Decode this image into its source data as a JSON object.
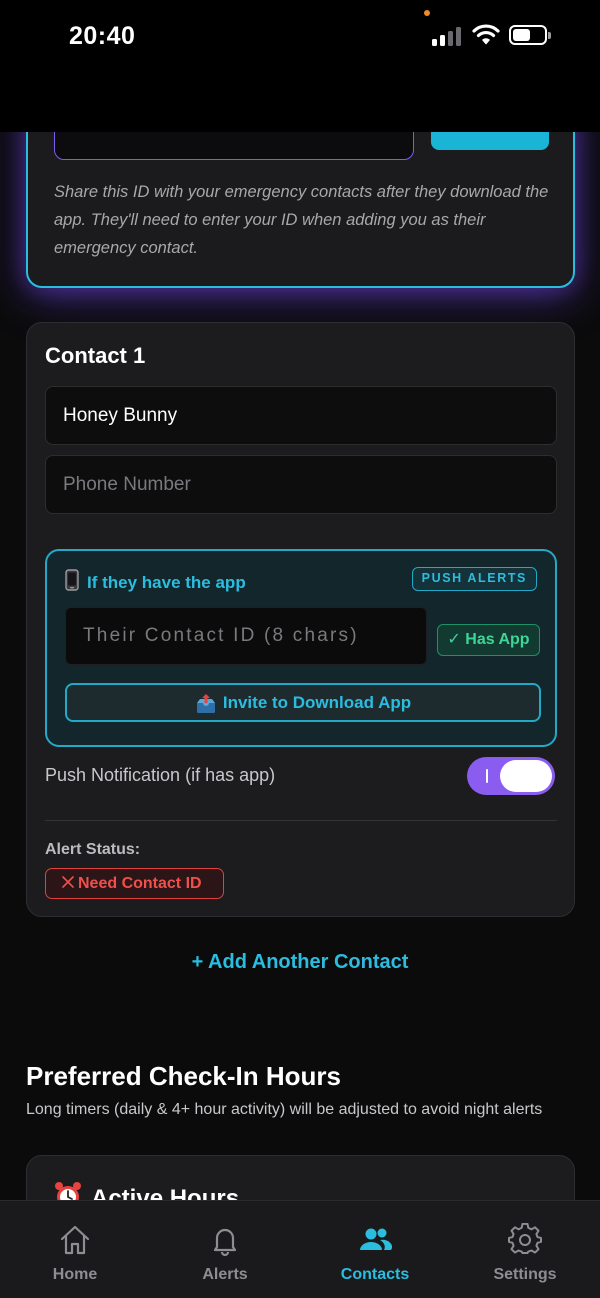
{
  "status_bar": {
    "time": "20:40"
  },
  "id_card": {
    "help_text": "Share this ID with your emergency contacts after they download the app. They'll need to enter your ID when adding you as their emergency contact."
  },
  "contact": {
    "title": "Contact 1",
    "name_value": "Honey Bunny",
    "phone_placeholder": "Phone Number",
    "app_section": {
      "icon": "mobile-phone-icon",
      "heading": "If they have the app",
      "badge": "PUSH ALERTS",
      "contact_id_placeholder": "Their Contact ID (8 chars)",
      "has_app_label": "✓ Has App",
      "invite_label": "Invite to Download App",
      "invite_icon": "outbox-tray-icon"
    },
    "push_label": "Push Notification (if has app)",
    "push_enabled": true,
    "alert_status_label": "Alert Status:",
    "alert_status_value": "Need Contact ID",
    "alert_status_icon": "cross-icon"
  },
  "add_contact_label": "+ Add Another Contact",
  "preferred_hours": {
    "title": "Preferred Check-In Hours",
    "subtitle": "Long timers (daily & 4+ hour activity) will be adjusted to avoid night alerts",
    "active_hours_title": "Active Hours",
    "active_hours_icon": "alarm-clock-icon"
  },
  "tabs": [
    {
      "label": "Home",
      "icon": "home-icon",
      "active": false
    },
    {
      "label": "Alerts",
      "icon": "bell-icon",
      "active": false
    },
    {
      "label": "Contacts",
      "icon": "people-icon",
      "active": true
    },
    {
      "label": "Settings",
      "icon": "gear-icon",
      "active": false
    }
  ],
  "colors": {
    "accent_cyan": "#2bbde0",
    "accent_purple": "#8a5cf0",
    "success_green": "#3ed598",
    "error_red": "#f0504d",
    "background": "#0b0b0c",
    "card": "#1c1c1e"
  }
}
